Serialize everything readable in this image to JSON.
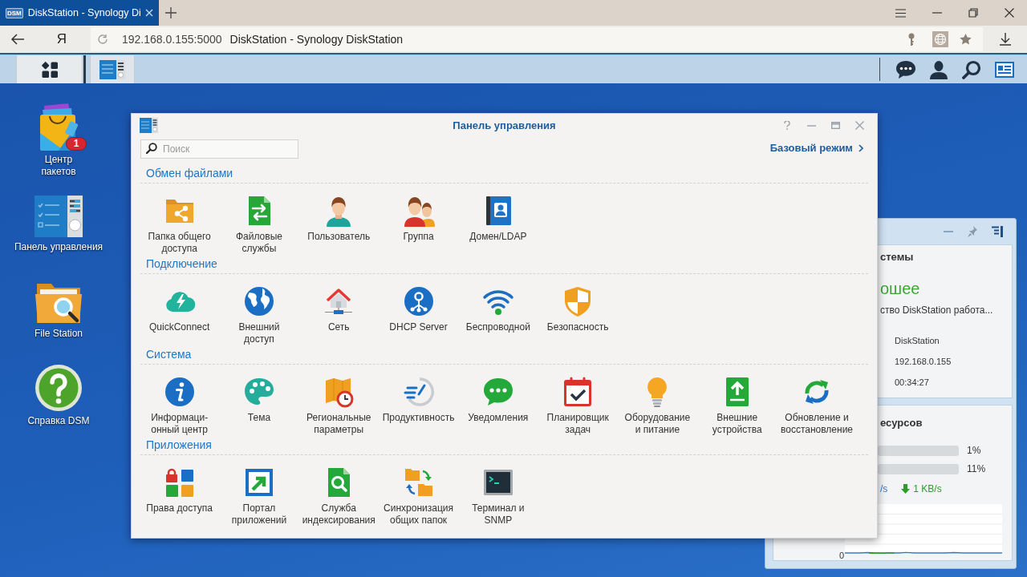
{
  "browser": {
    "favicon_text": "DSM",
    "tab_title": "DiskStation - Synology Di",
    "yandex_button": "Я",
    "url": "192.168.0.155:5000",
    "page_title": "DiskStation - Synology DiskStation"
  },
  "desktop": {
    "icons": [
      {
        "kind": "package_center",
        "label": "Центр\nпакетов",
        "badge": "1"
      },
      {
        "kind": "control_panel",
        "label": "Панель управления"
      },
      {
        "kind": "file_station",
        "label": "File Station"
      },
      {
        "kind": "help",
        "label": "Справка DSM"
      }
    ]
  },
  "widget": {
    "health": {
      "title": "стемы",
      "status": "ошее",
      "message": "ство DiskStation работа...",
      "details": [
        "DiskStation",
        "192.168.0.155",
        "00:34:27"
      ]
    },
    "resources": {
      "title": "есурсов",
      "meters": [
        {
          "reading": "1%"
        },
        {
          "reading": "11%"
        }
      ],
      "upload": "/s",
      "download": "1 KB/s",
      "chart_axis_label": "0"
    }
  },
  "control_panel": {
    "title": "Панель управления",
    "search": {
      "placeholder": "Поиск"
    },
    "mode_link": "Базовый режим",
    "sections": [
      {
        "title": "Обмен файлами",
        "items": [
          {
            "kind": "shared_folder",
            "label": "Папка общего\nдоступа"
          },
          {
            "kind": "file_services",
            "label": "Файловые\nслужбы"
          },
          {
            "kind": "user",
            "label": "Пользователь"
          },
          {
            "kind": "group",
            "label": "Группа"
          },
          {
            "kind": "domain",
            "label": "Домен/LDAP"
          }
        ]
      },
      {
        "title": "Подключение",
        "items": [
          {
            "kind": "quickconnect",
            "label": "QuickConnect"
          },
          {
            "kind": "external_access",
            "label": "Внешний\nдоступ"
          },
          {
            "kind": "network",
            "label": "Сеть"
          },
          {
            "kind": "dhcp",
            "label": "DHCP Server"
          },
          {
            "kind": "wireless",
            "label": "Беспроводной"
          },
          {
            "kind": "security",
            "label": "Безопасность"
          }
        ]
      },
      {
        "title": "Система",
        "items": [
          {
            "kind": "info_center",
            "label": "Информаци-\nонный центр"
          },
          {
            "kind": "theme",
            "label": "Тема"
          },
          {
            "kind": "regional",
            "label": "Региональные\nпараметры"
          },
          {
            "kind": "performance",
            "label": "Продуктивность"
          },
          {
            "kind": "notifications",
            "label": "Уведомления"
          },
          {
            "kind": "task_scheduler",
            "label": "Планировщик\nзадач"
          },
          {
            "kind": "hardware",
            "label": "Оборудование\nи питание"
          },
          {
            "kind": "external_devices",
            "label": "Внешние\nустройства"
          },
          {
            "kind": "update",
            "label": "Обновление и\nвосстановление"
          }
        ]
      },
      {
        "title": "Приложения",
        "items": [
          {
            "kind": "privileges",
            "label": "Права доступа"
          },
          {
            "kind": "portal",
            "label": "Портал\nприложений"
          },
          {
            "kind": "indexing",
            "label": "Служба\nиндексирования"
          },
          {
            "kind": "shared_folder_sync",
            "label": "Синхронизация\nобщих папок"
          },
          {
            "kind": "terminal",
            "label": "Терминал и\nSNMP"
          }
        ]
      }
    ]
  }
}
